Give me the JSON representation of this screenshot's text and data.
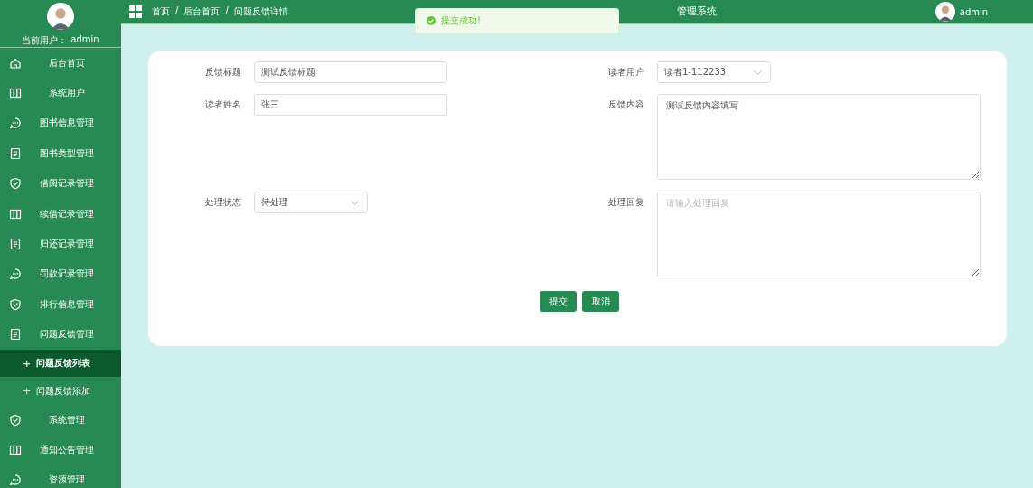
{
  "sidebar": {
    "current_user_label": "当前用户：",
    "current_user": "admin",
    "items": [
      {
        "kind": "home",
        "label": "后台首页",
        "selected": false
      },
      {
        "kind": "columns",
        "label": "系统用户",
        "selected": false
      },
      {
        "kind": "chat",
        "label": "图书信息管理",
        "selected": false
      },
      {
        "kind": "doc",
        "label": "图书类型管理",
        "selected": false
      },
      {
        "kind": "shield",
        "label": "借阅记录管理",
        "selected": false
      },
      {
        "kind": "columns",
        "label": "续借记录管理",
        "selected": false
      },
      {
        "kind": "doc",
        "label": "归还记录管理",
        "selected": false
      },
      {
        "kind": "chat",
        "label": "罚款记录管理",
        "selected": false
      },
      {
        "kind": "shield",
        "label": "排行信息管理",
        "selected": false
      },
      {
        "kind": "doc",
        "label": "问题反馈管理",
        "selected": false
      },
      {
        "kind": "sub",
        "icon_text": "+",
        "label": "问题反馈列表",
        "selected": true
      },
      {
        "kind": "sub",
        "icon_text": "+",
        "label": "问题反馈添加",
        "selected": false
      },
      {
        "kind": "shield",
        "label": "系统管理",
        "selected": false
      },
      {
        "kind": "columns",
        "label": "通知公告管理",
        "selected": false
      },
      {
        "kind": "chat",
        "label": "资源管理",
        "selected": false
      }
    ]
  },
  "header": {
    "breadcrumb": [
      "首页",
      "后台首页",
      "问题反馈详情"
    ],
    "separator": "/",
    "title": "管理系统",
    "user": "admin"
  },
  "toast": {
    "message": "提交成功!"
  },
  "form": {
    "title": {
      "label": "反馈标题",
      "value": "测试反馈标题"
    },
    "reader_user": {
      "label": "读者用户",
      "value": "读者1-112233"
    },
    "reader_name": {
      "label": "读者姓名",
      "value": "张三"
    },
    "content": {
      "label": "反馈内容",
      "value": "测试反馈内容填写"
    },
    "status": {
      "label": "处理状态",
      "value": "待处理"
    },
    "reply": {
      "label": "处理回复",
      "placeholder": "请输入处理回复"
    },
    "buttons": [
      "提交",
      "取消"
    ]
  }
}
